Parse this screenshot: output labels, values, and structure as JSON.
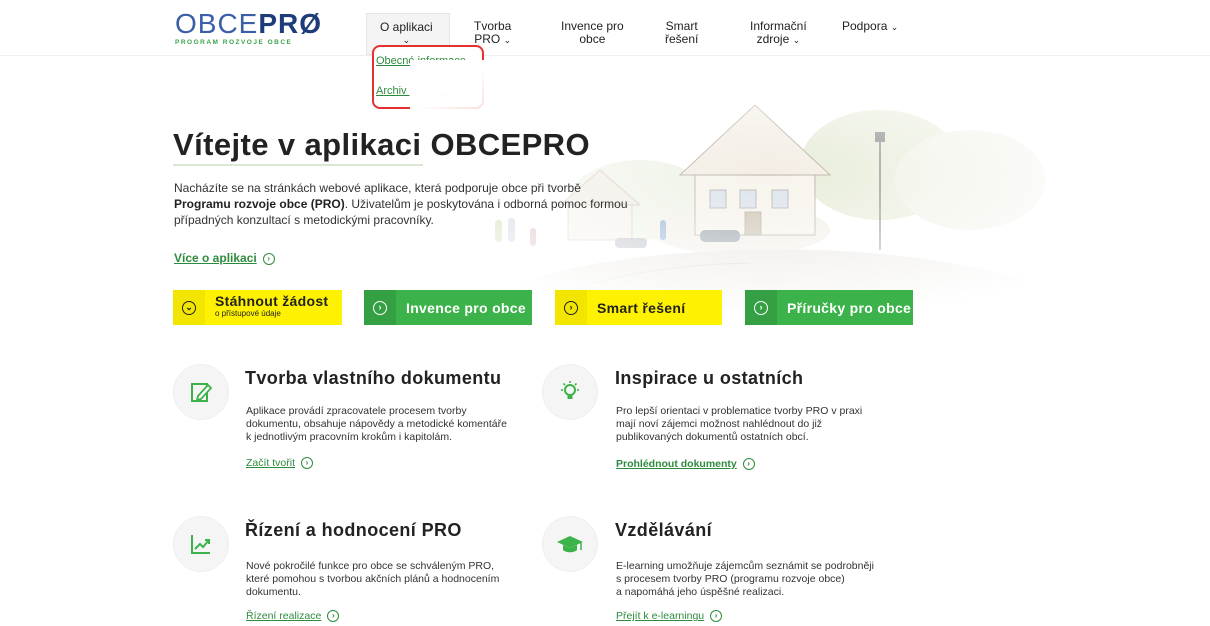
{
  "logo": {
    "name_thin": "OBCE",
    "name_bold": "PRØ",
    "tagline": "PROGRAM ROZVOJE OBCE"
  },
  "nav": [
    {
      "label": "O aplikaci",
      "chevron": "⌄"
    },
    {
      "label1": "Tvorba",
      "label2": "PRO"
    },
    {
      "label1": "Invence pro",
      "label2": "obce"
    },
    {
      "label1": "Smart",
      "label2": "řešení"
    },
    {
      "label1": "Informační",
      "label2": "zdroje"
    },
    {
      "label": "Podpora"
    }
  ],
  "dropdown": {
    "items": [
      "Obecné informace",
      "Archiv projektů"
    ]
  },
  "hero": {
    "title": "Vítejte v aplikaci OBCEPRO",
    "intro_before": "Nacházíte se na stránkách webové aplikace, která podporuje obce při tvorbě",
    "intro_bold": "Programu rozvoje obce (PRO)",
    "intro_after": ". Uživatelům je poskytována i odborná pomoc formou případných konzultací s metodickými pracovníky.",
    "more_link": "Více o aplikaci"
  },
  "buttons": [
    {
      "label": "Stáhnout žádost",
      "sub": "o přístupové údaje",
      "style": "yellow"
    },
    {
      "label": "Invence pro obce",
      "style": "green"
    },
    {
      "label": "Smart řešení",
      "style": "yellow"
    },
    {
      "label": "Příručky pro obce",
      "style": "green"
    }
  ],
  "features": [
    {
      "icon": "edit-document-icon",
      "title": "Tvorba vlastního dokumentu",
      "lines": [
        "Aplikace provádí zpracovatele procesem tvorby",
        "dokumentu, obsahuje nápovědy a metodické komentáře",
        "k jednotlivým pracovním krokům i kapitolám."
      ],
      "link": "Začít tvořit"
    },
    {
      "icon": "lightbulb-icon",
      "title": "Inspirace u ostatních",
      "lines": [
        "Pro lepší orientaci v problematice tvorby PRO v praxi",
        "mají noví zájemci možnost nahlédnout do již",
        "publikovaných dokumentů ostatních obcí."
      ],
      "link": "Prohlédnout dokumenty"
    },
    {
      "icon": "chart-trend-icon",
      "title": "Řízení a hodnocení PRO",
      "lines": [
        "Nové pokročilé funkce pro obce se schváleným PRO,",
        "které pomohou s tvorbou akčních plánů a hodnocením",
        "dokumentu."
      ],
      "link": "Řízení realizace"
    },
    {
      "icon": "graduation-cap-icon",
      "title": "Vzdělávání",
      "lines": [
        "E-learning umožňuje zájemcům seznámit se podrobněji",
        "s procesem tvorby PRO (programu rozvoje obce)",
        "a napomáhá jeho úspěšné realizaci."
      ],
      "link": "Přejít k e-learningu"
    }
  ],
  "colors": {
    "brand_green": "#3cb24a",
    "brand_yellow": "#fff200",
    "link_green": "#2e8b3e",
    "highlight_red": "#e53030"
  }
}
